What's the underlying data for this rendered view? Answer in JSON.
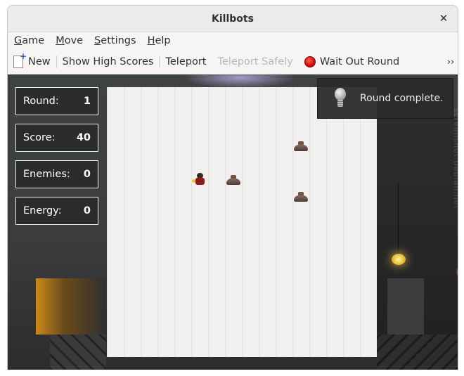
{
  "window": {
    "title": "Killbots"
  },
  "menu": [
    {
      "mnemonic": "G",
      "rest": "ame"
    },
    {
      "mnemonic": "M",
      "rest": "ove"
    },
    {
      "mnemonic": "S",
      "rest": "ettings"
    },
    {
      "mnemonic": "H",
      "rest": "elp"
    }
  ],
  "toolbar": {
    "new_label": "New",
    "high_scores_label": "Show High Scores",
    "teleport_label": "Teleport",
    "teleport_safely_label": "Teleport Safely",
    "wait_out_round_label": "Wait Out Round",
    "overflow_label": "››"
  },
  "stats": [
    {
      "label": "Round:",
      "value": "1"
    },
    {
      "label": "Score:",
      "value": "40"
    },
    {
      "label": "Enemies:",
      "value": "0"
    },
    {
      "label": "Energy:",
      "value": "0"
    }
  ],
  "notification": {
    "text": "Round complete."
  },
  "watermark": {
    "text": "screenshot.debian.net"
  },
  "board": {
    "columns": 16,
    "rows": 16,
    "hero": {
      "col": 5,
      "row": 5
    },
    "junkheaps": [
      {
        "col": 11,
        "row": 3
      },
      {
        "col": 7,
        "row": 5
      },
      {
        "col": 11,
        "row": 6
      }
    ]
  }
}
